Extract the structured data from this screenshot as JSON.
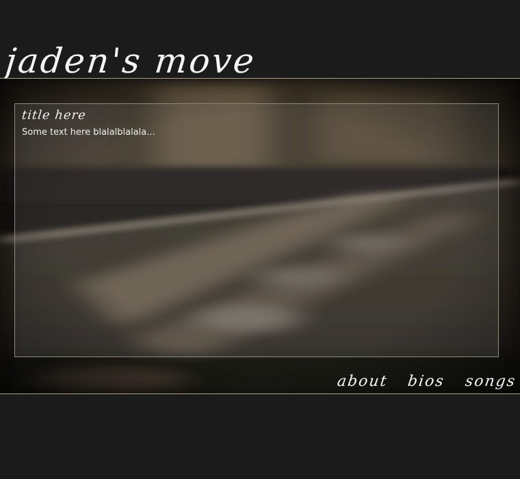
{
  "header": {
    "site_title": "jaden's move"
  },
  "content": {
    "title": "title here",
    "text": "Some text here blalalblalala..."
  },
  "nav": {
    "items": [
      {
        "label": "about"
      },
      {
        "label": "bios"
      },
      {
        "label": "songs"
      }
    ]
  },
  "colors": {
    "page_background": "#1b1b1b",
    "rule": "#a8a28f",
    "text": "#f2f2f2"
  }
}
